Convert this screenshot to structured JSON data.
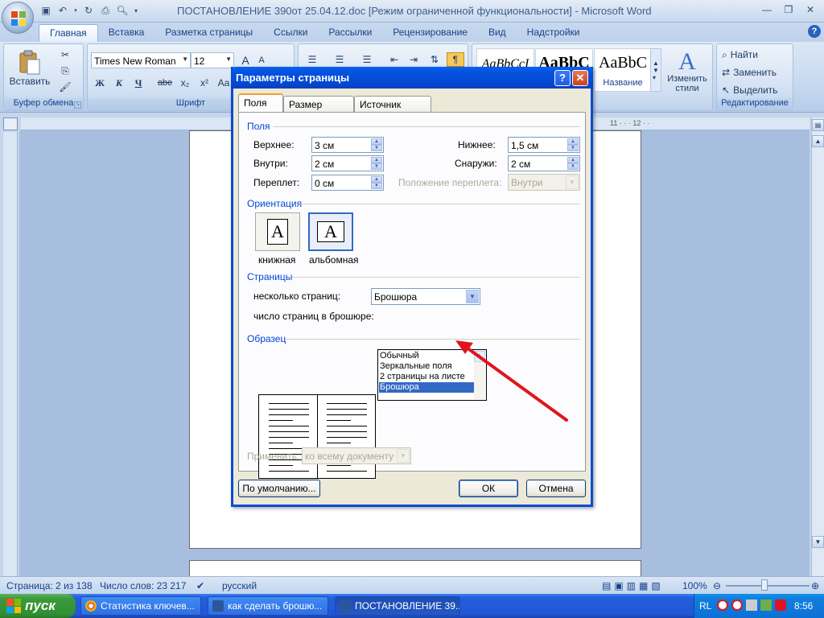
{
  "window": {
    "title": "ПОСТАНОВЛЕНИЕ 390от 25.04.12.doc [Режим ограниченной функциональности] - Microsoft Word"
  },
  "tabs": [
    "Главная",
    "Вставка",
    "Разметка страницы",
    "Ссылки",
    "Рассылки",
    "Рецензирование",
    "Вид",
    "Надстройки"
  ],
  "ribbon": {
    "clipboard": {
      "paste_label": "Вставить",
      "group_label": "Буфер обмена"
    },
    "font": {
      "name": "Times New Roman",
      "size": "12",
      "bold": "Ж",
      "italic": "К",
      "underline": "Ч",
      "strike": "abe",
      "group_label": "Шрифт"
    },
    "styles": [
      {
        "sample": "AaBbCcI",
        "caption": ""
      },
      {
        "sample": "AaBbC",
        "caption": ""
      },
      {
        "sample": "AaBbC",
        "caption": "Название"
      }
    ],
    "change_styles": "Изменить стили",
    "editing": {
      "find": "Найти",
      "replace": "Заменить",
      "select": "Выделить",
      "group_label": "Редактирование"
    }
  },
  "statusbar": {
    "page": "Страница: 2 из 138",
    "words": "Число слов: 23 217",
    "language": "русский",
    "zoom": "100%"
  },
  "taskbar": {
    "start": "пуск",
    "tasks": [
      "Статистика ключев...",
      "как сделать брошю...",
      "ПОСТАНОВЛЕНИЕ 39..."
    ],
    "lang": "RL",
    "clock": "8:56"
  },
  "dialog": {
    "title": "Параметры страницы",
    "tabs": [
      "Поля",
      "Размер бумаги",
      "Источник бумаги"
    ],
    "margins": {
      "section": "Поля",
      "top_label": "Верхнее:",
      "top": "3 см",
      "bottom_label": "Нижнее:",
      "bottom": "1,5 см",
      "inside_label": "Внутри:",
      "inside": "2 см",
      "outside_label": "Снаружи:",
      "outside": "2 см",
      "gutter_label": "Переплет:",
      "gutter": "0 см",
      "gutter_pos_label": "Положение переплета:",
      "gutter_pos": "Внутри"
    },
    "orientation": {
      "section": "Ориентация",
      "portrait": "книжная",
      "landscape": "альбомная",
      "icon_glyph": "A"
    },
    "pages": {
      "section": "Страницы",
      "multiple_label": "несколько страниц:",
      "multiple_value": "Брошюра",
      "sheets_label": "число страниц в брошюре:",
      "options": [
        "Обычный",
        "Зеркальные поля",
        "2 страницы на листе",
        "Брошюра"
      ],
      "selected_index": 3
    },
    "preview": {
      "section": "Образец"
    },
    "apply": {
      "label": "Применить:",
      "value": "ко всему документу"
    },
    "buttons": {
      "default": "По умолчанию...",
      "ok": "ОК",
      "cancel": "Отмена"
    }
  },
  "colors": {
    "dialog_title": "#0554e0",
    "selection": "#316ac5",
    "arrow": "#e0141e",
    "section_text": "#0046d5"
  }
}
